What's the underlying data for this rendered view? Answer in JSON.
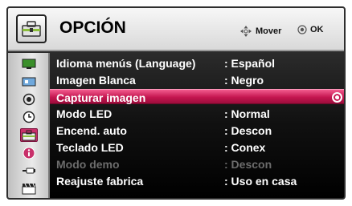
{
  "header": {
    "title": "OPCIÓN",
    "hint_move": "Mover",
    "hint_ok": "OK"
  },
  "sidebar": {
    "items": [
      {
        "icon": "picture-icon"
      },
      {
        "icon": "display-icon"
      },
      {
        "icon": "audio-icon"
      },
      {
        "icon": "time-icon"
      },
      {
        "icon": "option-icon",
        "active": true
      },
      {
        "icon": "info-icon"
      },
      {
        "icon": "input-icon"
      },
      {
        "icon": "media-icon"
      }
    ]
  },
  "menu": {
    "rows": [
      {
        "label": "Idioma menús (Language)",
        "value": ": Español"
      },
      {
        "label": "Imagen Blanca",
        "value": ": Negro"
      },
      {
        "label": "Capturar imagen",
        "value": "",
        "selected": true
      },
      {
        "label": "Modo LED",
        "value": ": Normal"
      },
      {
        "label": "Encend. auto",
        "value": ": Descon"
      },
      {
        "label": "Teclado LED",
        "value": ": Conex"
      },
      {
        "label": "Modo demo",
        "value": ": Descon",
        "disabled": true
      },
      {
        "label": "Reajuste fabrica",
        "value": ": Uso en casa"
      }
    ]
  },
  "colors": {
    "highlight": "#c4154f",
    "active_icon": "#c8306a",
    "disabled_text": "#6c6c6c"
  }
}
